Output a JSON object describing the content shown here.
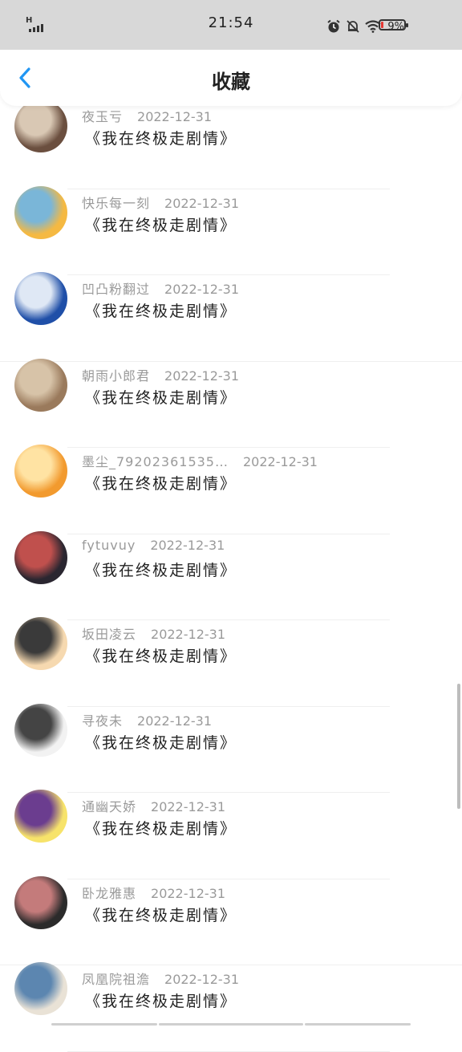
{
  "status_bar": {
    "network": "H",
    "time": "21:54",
    "battery_pct": "9%",
    "battery_level": 0.09,
    "icons": [
      "signal-icon",
      "alarm-icon",
      "mute-icon",
      "wifi-icon",
      "battery-icon"
    ]
  },
  "header": {
    "title": "收藏",
    "back_icon": "chevron-left-icon",
    "accent": "#2196f3"
  },
  "items": [
    {
      "name": "夜玉亏",
      "date": "2022-12-31",
      "book": "《我在终极走剧情》",
      "avatar_colors": [
        "#6b4f3f",
        "#d9c8b4"
      ]
    },
    {
      "name": "快乐每一刻",
      "date": "2022-12-31",
      "book": "《我在终极走剧情》",
      "avatar_colors": [
        "#f5b942",
        "#7ab6d8"
      ]
    },
    {
      "name": "凹凸粉翻过",
      "date": "2022-12-31",
      "book": "《我在终极走剧情》",
      "avatar_colors": [
        "#1f4fa8",
        "#dfe8f5"
      ]
    },
    {
      "name": "朝雨小郎君",
      "date": "2022-12-31",
      "book": "《我在终极走剧情》",
      "avatar_colors": [
        "#9a7a5c",
        "#d7c3a8"
      ]
    },
    {
      "name": "墨尘_79202361535…",
      "date": "2022-12-31",
      "book": "《我在终极走剧情》",
      "avatar_colors": [
        "#f29a2e",
        "#ffe3a3"
      ]
    },
    {
      "name": "fytuvuy",
      "date": "2022-12-31",
      "book": "《我在终极走剧情》",
      "avatar_colors": [
        "#2a2630",
        "#c0504d"
      ]
    },
    {
      "name": "坂田凌云",
      "date": "2022-12-31",
      "book": "《我在终极走剧情》",
      "avatar_colors": [
        "#f6d9b0",
        "#3a3a3a"
      ]
    },
    {
      "name": "寻夜未",
      "date": "2022-12-31",
      "book": "《我在终极走剧情》",
      "avatar_colors": [
        "#f2f2f2",
        "#444444"
      ]
    },
    {
      "name": "通幽天娇",
      "date": "2022-12-31",
      "book": "《我在终极走剧情》",
      "avatar_colors": [
        "#f7e36a",
        "#6b3d8f"
      ]
    },
    {
      "name": "卧龙雅惠",
      "date": "2022-12-31",
      "book": "《我在终极走剧情》",
      "avatar_colors": [
        "#2b2b2b",
        "#c47b7b"
      ]
    },
    {
      "name": "凤凰院祖澹",
      "date": "2022-12-31",
      "book": "《我在终极走剧情》",
      "avatar_colors": [
        "#e9e2d6",
        "#5c86b0"
      ]
    }
  ]
}
